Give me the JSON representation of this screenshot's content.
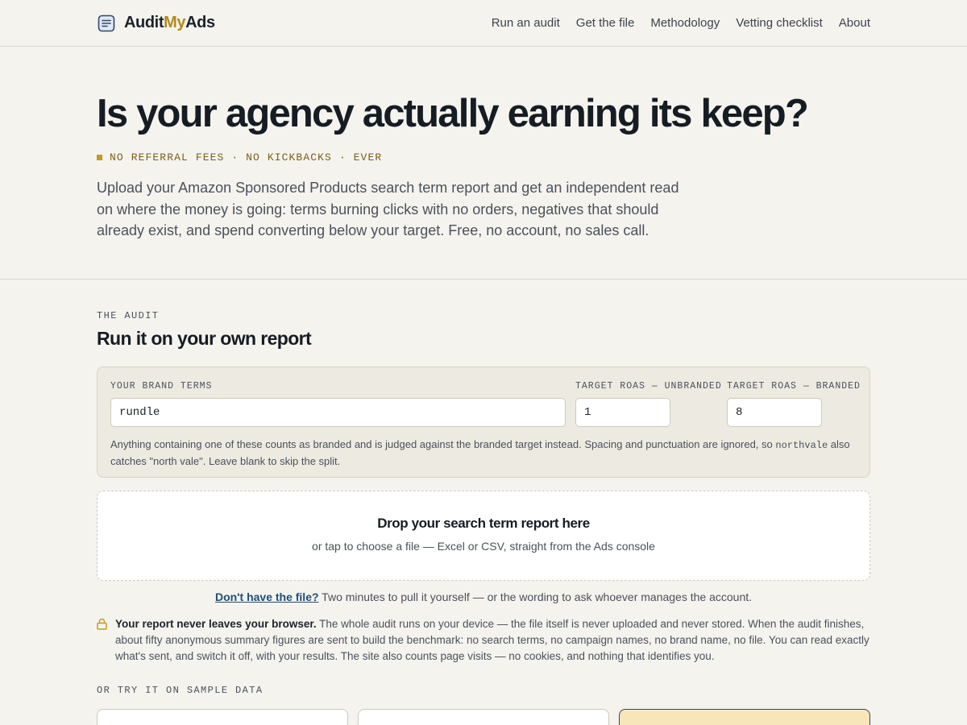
{
  "brand": {
    "name_part1": "Audit",
    "name_part2": "My",
    "name_part3": "Ads"
  },
  "nav": [
    {
      "label": "Run an audit"
    },
    {
      "label": "Get the file"
    },
    {
      "label": "Methodology"
    },
    {
      "label": "Vetting checklist"
    },
    {
      "label": "About"
    }
  ],
  "hero": {
    "title": "Is your agency actually earning its keep?",
    "tagline": "NO REFERRAL FEES · NO KICKBACKS · EVER",
    "lede": "Upload your Amazon Sponsored Products search term report and get an independent read on where the money is going: terms burning clicks with no orders, negatives that should already exist, and spend converting below your target. Free, no account, no sales call."
  },
  "audit": {
    "eyebrow": "THE AUDIT",
    "title": "Run it on your own report",
    "fields": {
      "brand_label": "YOUR BRAND TERMS",
      "brand_value": "rundle",
      "unbranded_label": "TARGET ROAS — UNBRANDED",
      "unbranded_value": "1",
      "branded_label": "TARGET ROAS — BRANDED",
      "branded_value": "8"
    },
    "help": {
      "part1": "Anything containing one of these counts as branded and is judged against the branded target instead. Spacing and punctuation are ignored, so ",
      "code": "northvale",
      "part2": " also catches \"north vale\". Leave blank to skip the split."
    },
    "dropzone": {
      "title": "Drop your search term report here",
      "subtitle": "or tap to choose a file — Excel or CSV, straight from the Ads console"
    },
    "file_hint": {
      "link": "Don't have the file?",
      "text": " Two minutes to pull it yourself — or the wording to ask whoever manages the account."
    },
    "privacy": {
      "strong": "Your report never leaves your browser.",
      "text": " The whole audit runs on your device — the file itself is never uploaded and never stored. When the audit finishes, about fifty anonymous summary figures are sent to build the benchmark: no search terms, no campaign names, no brand name, no file. You can read exactly what's sent, and switch it off, with your results. The site also counts page visits — no cookies, and nothing that identifies you."
    },
    "sample_label": "OR TRY IT ON SAMPLE DATA"
  },
  "colors": {
    "background": "#f5f3ee",
    "accent_gold": "#b08a1e",
    "link_blue": "#1e4e78",
    "active_card": "#f7e6b9"
  },
  "icons": {
    "logo": "document-lines-icon",
    "privacy": "lock-icon"
  }
}
